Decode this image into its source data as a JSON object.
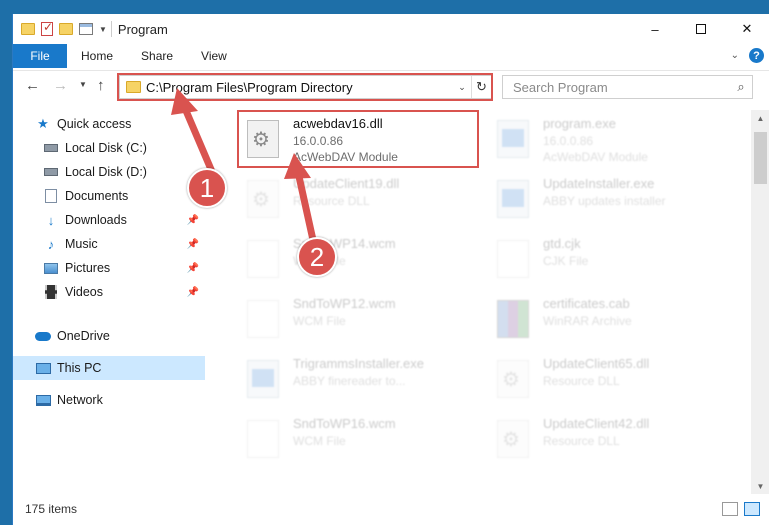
{
  "window": {
    "title": "Program",
    "controls": {
      "minimize": "–",
      "close": "✕"
    }
  },
  "ribbon": {
    "tabs": [
      "File",
      "Home",
      "Share",
      "View"
    ],
    "help": "?"
  },
  "navbar": {
    "back": "←",
    "forward": "→",
    "up": "↑",
    "address": "C:\\Program Files\\Program Directory",
    "refresh": "↻",
    "search_placeholder": "Search Program"
  },
  "sidebar": {
    "items": [
      {
        "label": "Quick access",
        "icon": "star-icon",
        "pinned": false
      },
      {
        "label": "Local Disk (C:)",
        "icon": "drive-icon",
        "pinned": false
      },
      {
        "label": "Local Disk (D:)",
        "icon": "drive-icon",
        "pinned": false
      },
      {
        "label": "Documents",
        "icon": "documents-icon",
        "pinned": false
      },
      {
        "label": "Downloads",
        "icon": "download-icon",
        "pinned": true
      },
      {
        "label": "Music",
        "icon": "music-icon",
        "pinned": true
      },
      {
        "label": "Pictures",
        "icon": "pictures-icon",
        "pinned": true
      },
      {
        "label": "Videos",
        "icon": "videos-icon",
        "pinned": true
      },
      {
        "label": "OneDrive",
        "icon": "cloud-icon",
        "pinned": false
      },
      {
        "label": "This PC",
        "icon": "computer-icon",
        "pinned": false,
        "selected": true
      },
      {
        "label": "Network",
        "icon": "network-icon",
        "pinned": false
      }
    ]
  },
  "files": [
    {
      "name": "acwebdav16.dll",
      "line2": "16.0.0.86",
      "line3": "AcWebDAV Module",
      "icon": "dll-icon",
      "highlighted": true
    },
    {
      "name": "program.exe",
      "line2": "16.0.0.86",
      "line3": "AcWebDAV Module",
      "icon": "exe-icon"
    },
    {
      "name": "UpdateClient19.dll",
      "line2": "Resource DLL",
      "line3": "",
      "icon": "dll-icon"
    },
    {
      "name": "UpdateInstaller.exe",
      "line2": "ABBY updates installer",
      "line3": "",
      "icon": "exe-icon"
    },
    {
      "name": "SndToWP14.wcm",
      "line2": "WCM File",
      "line3": "",
      "icon": "blank-file-icon"
    },
    {
      "name": "gtd.cjk",
      "line2": "CJK File",
      "line3": "",
      "icon": "blank-file-icon"
    },
    {
      "name": "SndToWP12.wcm",
      "line2": "WCM File",
      "line3": "",
      "icon": "blank-file-icon"
    },
    {
      "name": "certificates.cab",
      "line2": "WinRAR Archive",
      "line3": "",
      "icon": "rar-icon"
    },
    {
      "name": "TrigrammsInstaller.exe",
      "line2": "ABBY finereader to...",
      "line3": "",
      "icon": "exe-icon"
    },
    {
      "name": "UpdateClient65.dll",
      "line2": "Resource DLL",
      "line3": "",
      "icon": "dll-icon"
    },
    {
      "name": "SndToWP16.wcm",
      "line2": "WCM File",
      "line3": "",
      "icon": "blank-file-icon"
    },
    {
      "name": "UpdateClient42.dll",
      "line2": "Resource DLL",
      "line3": "",
      "icon": "dll-icon"
    }
  ],
  "annotations": {
    "step1": "1",
    "step2": "2",
    "color": "#d9534f"
  },
  "status": {
    "count": "175 items"
  },
  "colors": {
    "accent": "#1979ca",
    "selected_bg": "#cce8ff"
  }
}
